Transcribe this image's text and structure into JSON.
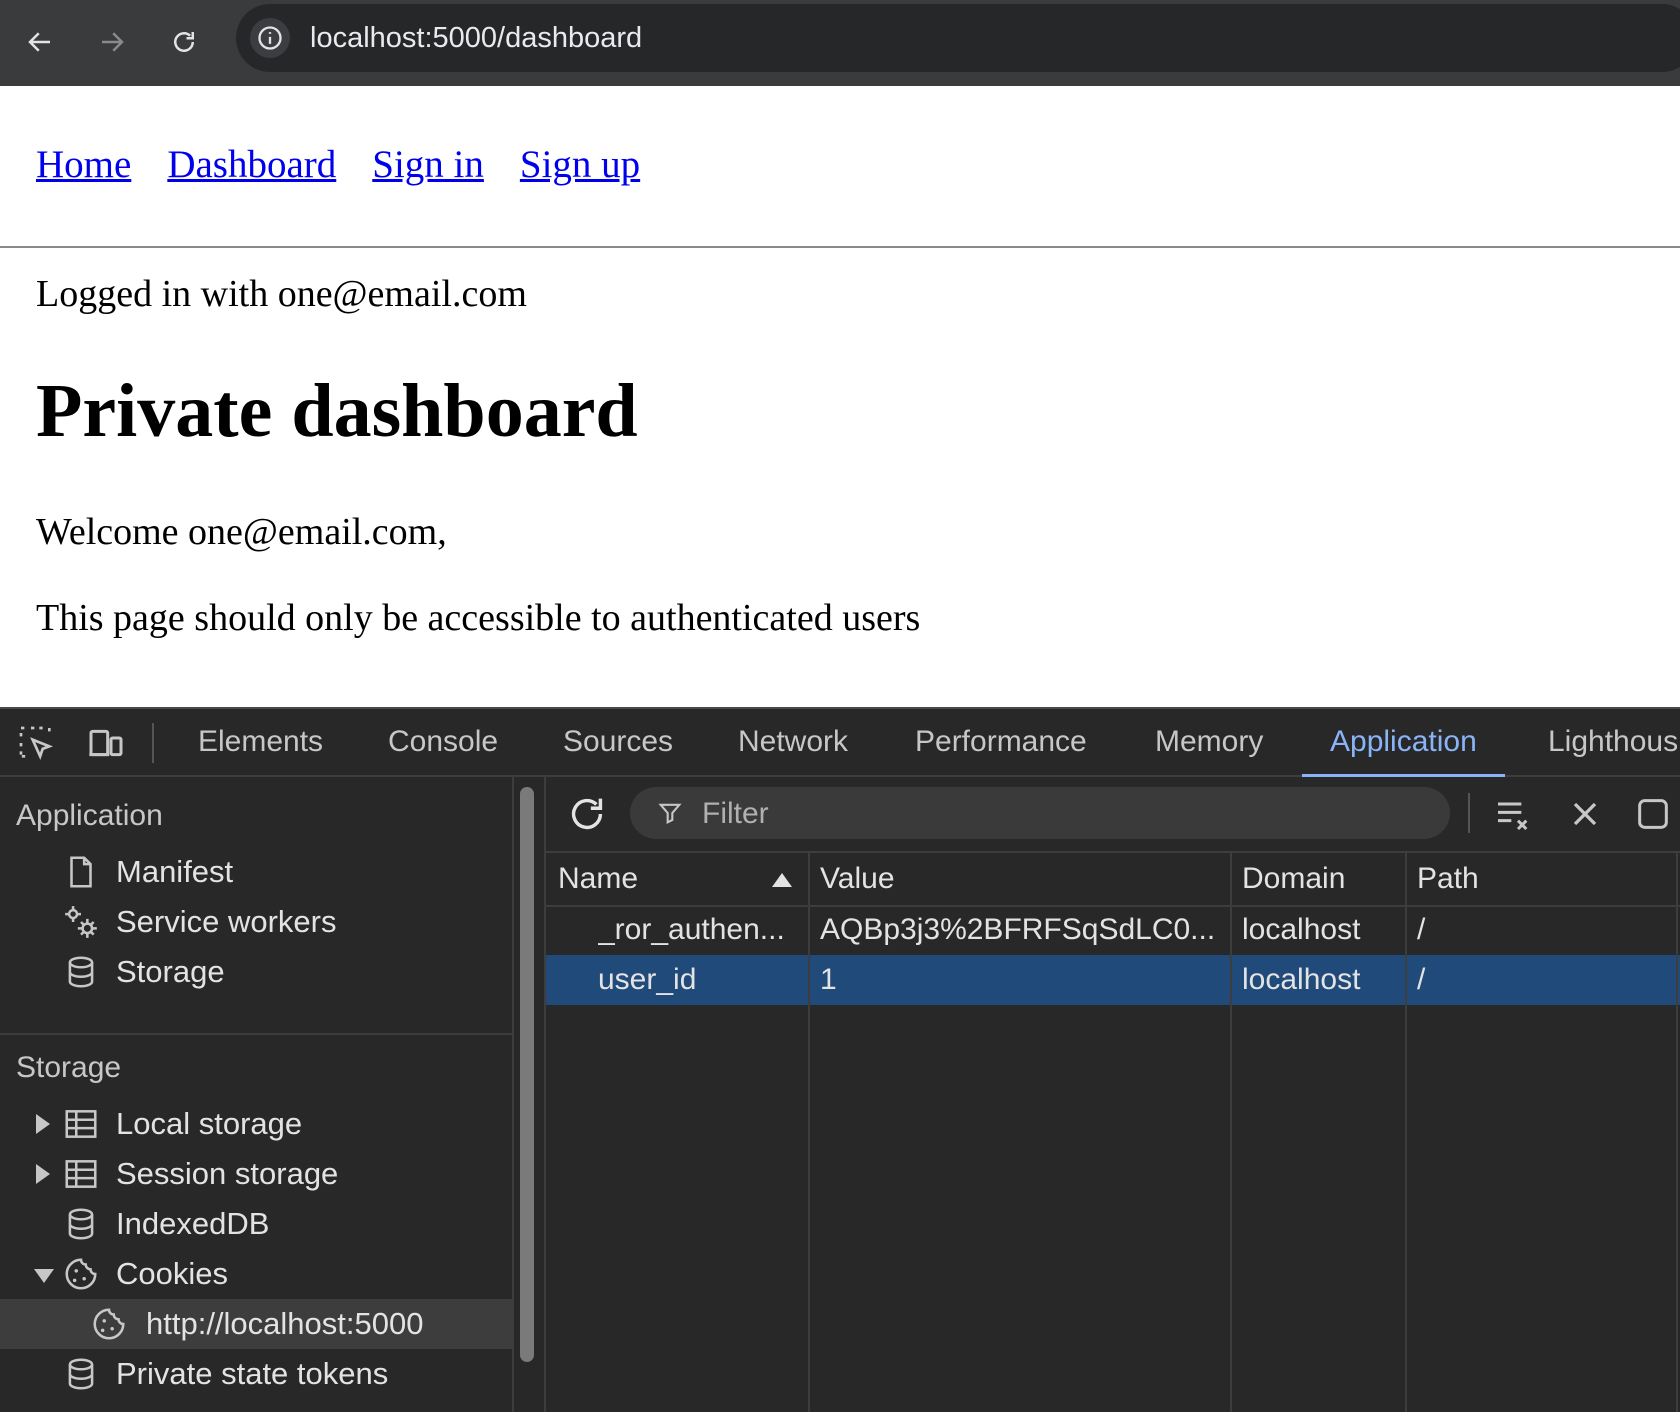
{
  "browser": {
    "url": "localhost:5000/dashboard",
    "back_icon": "arrow-left-icon",
    "forward_icon": "arrow-right-icon",
    "reload_icon": "reload-icon",
    "site_info_icon": "info-icon"
  },
  "page": {
    "nav": [
      "Home",
      "Dashboard",
      "Sign in",
      "Sign up"
    ],
    "logged_in": "Logged in with one@email.com",
    "title": "Private dashboard",
    "welcome": "Welcome one@email.com,",
    "note": "This page should only be accessible to authenticated users"
  },
  "devtools": {
    "tabs": [
      "Elements",
      "Console",
      "Sources",
      "Network",
      "Performance",
      "Memory",
      "Application",
      "Lighthous"
    ],
    "active_tab": "Application",
    "accent_color": "#8ab4f8",
    "sidebar": {
      "application_heading": "Application",
      "application_items": [
        "Manifest",
        "Service workers",
        "Storage"
      ],
      "storage_heading": "Storage",
      "storage_items": [
        "Local storage",
        "Session storage",
        "IndexedDB",
        "Cookies"
      ],
      "cookies_child": "http://localhost:5000",
      "last_item": "Private state tokens"
    },
    "filter_placeholder": "Filter",
    "columns": [
      "Name",
      "Value",
      "Domain",
      "Path"
    ],
    "rows": [
      {
        "name": "_ror_authen...",
        "value": "AQBp3j3%2BFRFSqSdLC0...",
        "domain": "localhost",
        "path": "/"
      },
      {
        "name": "user_id",
        "value": "1",
        "domain": "localhost",
        "path": "/"
      }
    ],
    "selected_row_color": "#1f4a7a"
  }
}
